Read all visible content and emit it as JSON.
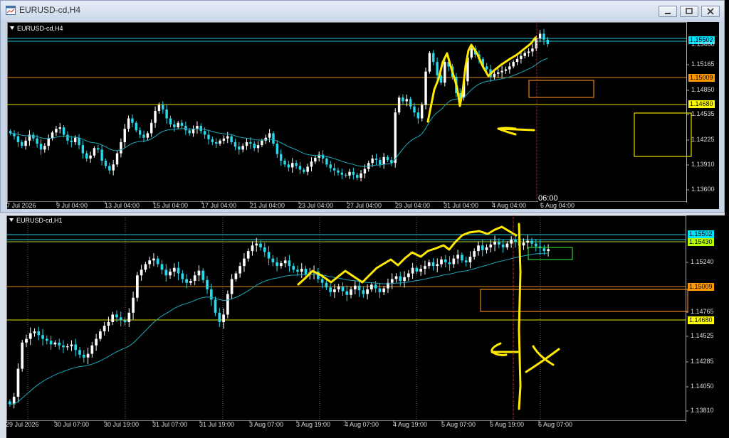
{
  "window": {
    "title": "EURUSD-cd,H4"
  },
  "chart_data": [
    {
      "type": "candlestick",
      "symbol_label": "EURUSD-cd,H4",
      "y_axis_ticks": [
        "1.15165",
        "1.14850",
        "1.14535",
        "1.14225",
        "1.13910",
        "1.13600"
      ],
      "ylim": [
        1.1352,
        1.1574
      ],
      "price_tags": [
        {
          "value": "1.15502",
          "bg": "#00e5ff",
          "fg": "#000"
        },
        {
          "value": "1.15009",
          "bg": "#ff9900",
          "fg": "#000"
        },
        {
          "value": "1.14680",
          "bg": "#ffff00",
          "fg": "#000"
        }
      ],
      "hidden_tag": "1.15460",
      "x_axis_labels": [
        "7 Jul 2026",
        "9 Jul 04:00",
        "13 Jul 04:00",
        "15 Jul 04:00",
        "17 Jul 04:00",
        "21 Jul 04:00",
        "23 Jul 04:00",
        "27 Jul 04:00",
        "29 Jul 04:00",
        "31 Jul 04:00",
        "4 Aug 04:00",
        "6 Aug 04:00"
      ],
      "crosshair_time": "06:00",
      "series": [
        {
          "closes": [
            1.1432,
            1.1428,
            1.142,
            1.1415,
            1.1422,
            1.143,
            1.1425,
            1.1418,
            1.141,
            1.1415,
            1.1425,
            1.1433,
            1.1438,
            1.144,
            1.143,
            1.1422,
            1.142,
            1.1426,
            1.1416,
            1.1405,
            1.1398,
            1.1402,
            1.1412,
            1.141,
            1.1395,
            1.1388,
            1.1382,
            1.139,
            1.1405,
            1.142,
            1.1438,
            1.1452,
            1.1446,
            1.1436,
            1.143,
            1.1426,
            1.1432,
            1.1446,
            1.1462,
            1.147,
            1.1464,
            1.1452,
            1.1444,
            1.144,
            1.1446,
            1.1442,
            1.1436,
            1.1432,
            1.1438,
            1.1442,
            1.1435,
            1.143,
            1.1424,
            1.142,
            1.1418,
            1.1422,
            1.1425,
            1.1428,
            1.142,
            1.1414,
            1.141,
            1.1415,
            1.142,
            1.1418,
            1.1412,
            1.1416,
            1.1422,
            1.1426,
            1.1432,
            1.1418,
            1.1404,
            1.1395,
            1.139,
            1.1386,
            1.1392,
            1.1388,
            1.1383,
            1.138,
            1.1387,
            1.1394,
            1.1399,
            1.1403,
            1.1398,
            1.139,
            1.1385,
            1.1382,
            1.1379,
            1.1376,
            1.1375,
            1.138,
            1.1376,
            1.1372,
            1.1378,
            1.1384,
            1.1392,
            1.1398,
            1.1396,
            1.139,
            1.14,
            1.1396,
            1.1392,
            1.146,
            1.148,
            1.1475,
            1.1478,
            1.1468,
            1.146,
            1.1452,
            1.147,
            1.1515,
            1.154,
            1.1528,
            1.151,
            1.15,
            1.1528,
            1.1522,
            1.1508,
            1.1486,
            1.148,
            1.1502,
            1.1534,
            1.1546,
            1.1538,
            1.1532,
            1.1522,
            1.1518,
            1.1508,
            1.1512,
            1.1514,
            1.1516,
            1.1518,
            1.1522,
            1.1528,
            1.1532,
            1.1536,
            1.154,
            1.1542,
            1.1546,
            1.156,
            1.1566,
            1.1558,
            1.1552
          ]
        }
      ]
    },
    {
      "type": "candlestick",
      "symbol_label": "EURUSD-cd,H1",
      "y_axis_ticks": [
        "1.15240",
        "1.14765",
        "1.14525",
        "1.14285",
        "1.14050",
        "1.13810"
      ],
      "ylim": [
        1.1374,
        1.1575
      ],
      "price_tags": [
        {
          "value": "1.15502",
          "bg": "#00e5ff",
          "fg": "#000"
        },
        {
          "value": "1.15430",
          "bg": "#b6ff00",
          "fg": "#000"
        },
        {
          "value": "1.15009",
          "bg": "#ff9900",
          "fg": "#000"
        },
        {
          "value": "1.14680",
          "bg": "#ffff00",
          "fg": "#000"
        }
      ],
      "x_axis_labels": [
        "29 Jul 2026",
        "30 Jul 07:00",
        "30 Jul 19:00",
        "31 Jul 07:00",
        "31 Jul 19:00",
        "3 Aug 07:00",
        "3 Aug 19:00",
        "4 Aug 07:00",
        "4 Aug 19:00",
        "5 Aug 07:00",
        "5 Aug 19:00",
        "6 Aug 07:00"
      ],
      "series": [
        {
          "closes": [
            1.1382,
            1.139,
            1.142,
            1.1448,
            1.1452,
            1.1458,
            1.146,
            1.1456,
            1.1452,
            1.145,
            1.1446,
            1.1448,
            1.1445,
            1.1443,
            1.1444,
            1.1446,
            1.144,
            1.1435,
            1.1432,
            1.1436,
            1.1445,
            1.1452,
            1.146,
            1.1466,
            1.147,
            1.1478,
            1.1475,
            1.1472,
            1.147,
            1.148,
            1.1496,
            1.152,
            1.1526,
            1.1532,
            1.1536,
            1.1538,
            1.1532,
            1.1526,
            1.152,
            1.1524,
            1.1528,
            1.1522,
            1.1516,
            1.1512,
            1.1514,
            1.152,
            1.1525,
            1.1515,
            1.1505,
            1.1494,
            1.148,
            1.147,
            1.1478,
            1.15,
            1.1516,
            1.1522,
            1.153,
            1.1538,
            1.1546,
            1.1552,
            1.1554,
            1.155,
            1.1545,
            1.1538,
            1.1534,
            1.153,
            1.1533,
            1.1536,
            1.153,
            1.1526,
            1.1524,
            1.1527,
            1.1521,
            1.1523,
            1.1524,
            1.1516,
            1.1512,
            1.1507,
            1.1502,
            1.1505,
            1.1508,
            1.1503,
            1.1499,
            1.1505,
            1.1509,
            1.1504,
            1.15,
            1.1505,
            1.151,
            1.1506,
            1.1502,
            1.1506,
            1.1512,
            1.1516,
            1.1519,
            1.1514,
            1.1518,
            1.1522,
            1.1528,
            1.1524,
            1.1527,
            1.153,
            1.1534,
            1.153,
            1.1532,
            1.1537,
            1.1534,
            1.1532,
            1.1538,
            1.1542,
            1.1536,
            1.1534,
            1.154,
            1.1546,
            1.1552,
            1.1547,
            1.155,
            1.1553,
            1.1556,
            1.1553,
            1.155,
            1.1554,
            1.1558,
            1.1556,
            1.1552,
            1.1555,
            1.1557,
            1.1554,
            1.1551,
            1.1549,
            1.1546,
            1.1548
          ]
        }
      ]
    }
  ]
}
